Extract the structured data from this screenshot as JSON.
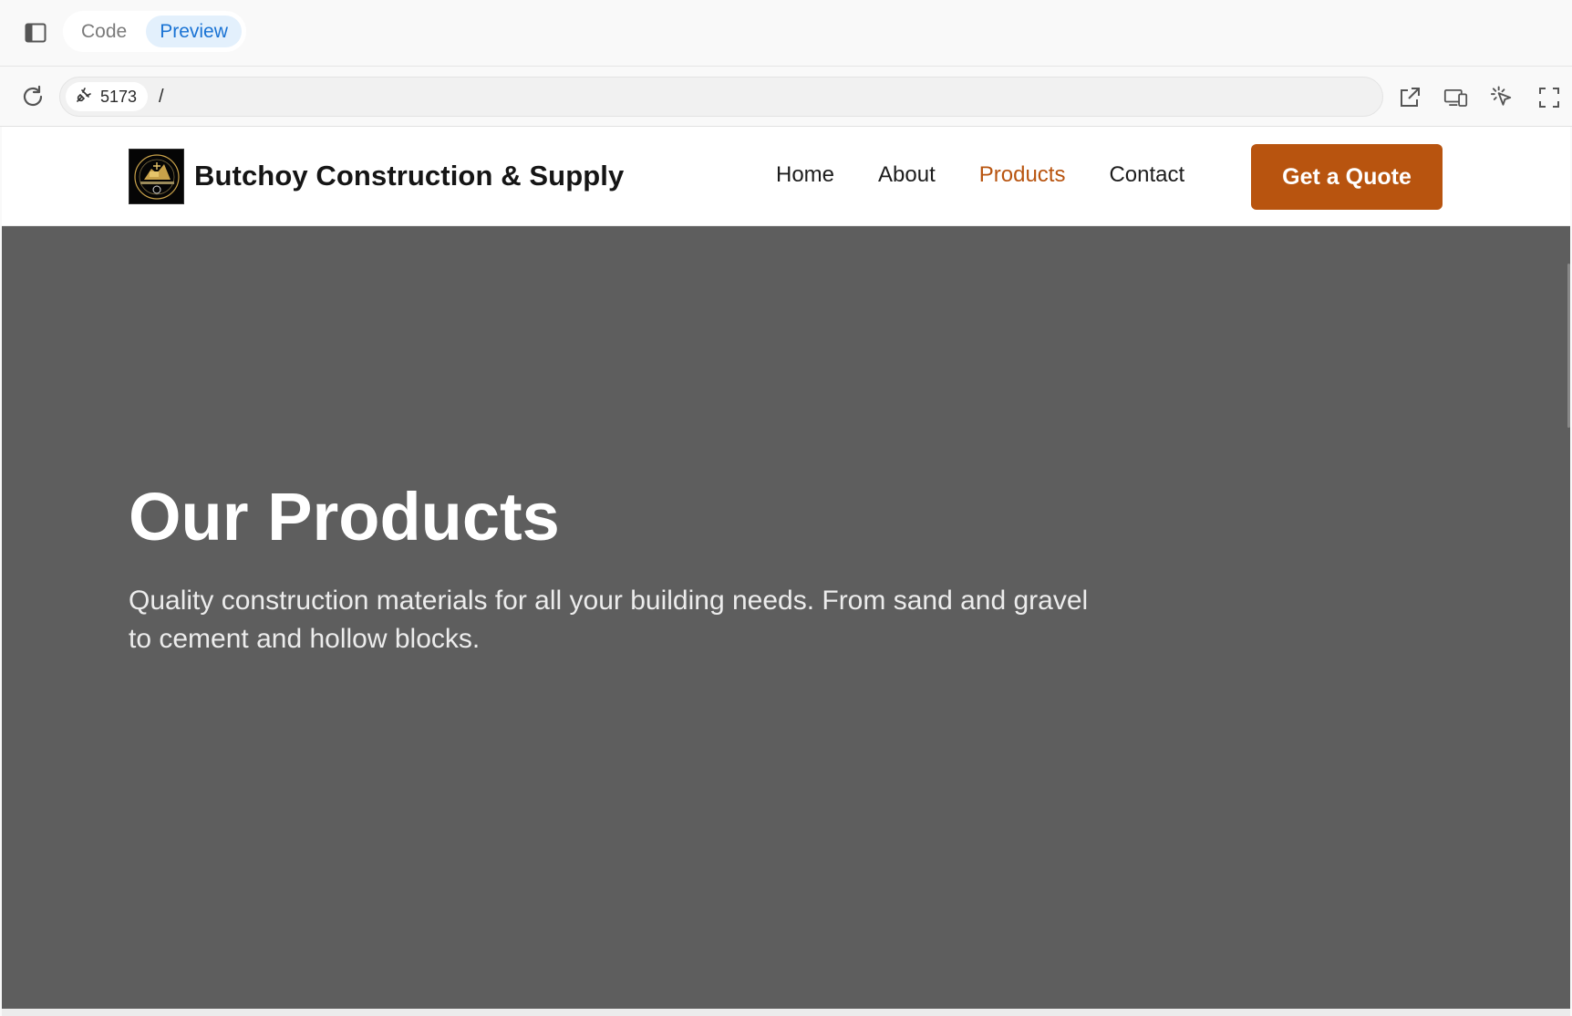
{
  "toolbar": {
    "tabs": [
      {
        "label": "Code",
        "active": false
      },
      {
        "label": "Preview",
        "active": true
      }
    ]
  },
  "urlbar": {
    "port": "5173",
    "path": "/"
  },
  "site": {
    "brand": "Butchoy Construction & Supply",
    "nav": [
      "Home",
      "About",
      "Products",
      "Contact"
    ],
    "active_nav": "Products",
    "cta_label": "Get a Quote",
    "accent_color": "#b8540f"
  },
  "hero": {
    "title": "Our Products",
    "subtitle_line1": "Quality construction materials for all your building needs. From sand and gravel",
    "subtitle_line2": "to cement and hollow blocks.",
    "background": "#5e5e5e"
  },
  "icons": {
    "sidebar": "sidebar-toggle-icon",
    "reload": "reload-icon",
    "plug": "plug-icon",
    "open_external": "open-external-icon",
    "devices": "responsive-devices-icon",
    "select": "element-select-icon",
    "fullscreen": "fullscreen-icon"
  }
}
